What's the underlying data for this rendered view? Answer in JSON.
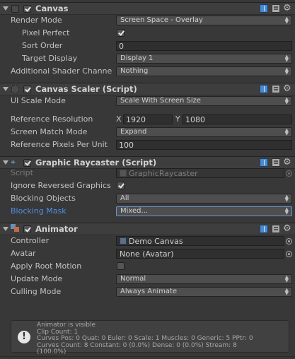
{
  "canvas": {
    "title": "Canvas",
    "render_mode_label": "Render Mode",
    "render_mode_value": "Screen Space - Overlay",
    "pixel_perfect_label": "Pixel Perfect",
    "sort_order_label": "Sort Order",
    "sort_order_value": "0",
    "target_display_label": "Target Display",
    "target_display_value": "Display 1",
    "shader_channels_label": "Additional Shader Channe",
    "shader_channels_value": "Nothing"
  },
  "canvas_scaler": {
    "title": "Canvas Scaler (Script)",
    "ui_scale_mode_label": "UI Scale Mode",
    "ui_scale_mode_value": "Scale With Screen Size",
    "ref_resolution_label": "Reference Resolution",
    "x_label": "X",
    "x_value": "1920",
    "y_label": "Y",
    "y_value": "1080",
    "match_mode_label": "Screen Match Mode",
    "match_mode_value": "Expand",
    "ref_ppu_label": "Reference Pixels Per Unit",
    "ref_ppu_value": "100"
  },
  "graphic_raycaster": {
    "title": "Graphic Raycaster (Script)",
    "script_label": "Script",
    "script_value": "GraphicRaycaster",
    "ignore_reversed_label": "Ignore Reversed Graphics",
    "blocking_objects_label": "Blocking Objects",
    "blocking_objects_value": "All",
    "blocking_mask_label": "Blocking Mask",
    "blocking_mask_value": "Mixed..."
  },
  "animator": {
    "title": "Animator",
    "controller_label": "Controller",
    "controller_value": "Demo Canvas",
    "avatar_label": "Avatar",
    "avatar_value": "None (Avatar)",
    "apply_root_motion_label": "Apply Root Motion",
    "update_mode_label": "Update Mode",
    "update_mode_value": "Normal",
    "culling_mode_label": "Culling Mode",
    "culling_mode_value": "Always Animate",
    "info_text": "Animator is visible\nClip Count: 1\nCurves Pos: 0 Quat: 0 Euler: 0 Scale: 1 Muscles: 0 Generic: 5 PPtr: 0\nCurves Count: 8 Constant: 0 (0.0%) Dense: 0 (0.0%) Stream: 8\n(100.0%)"
  },
  "icons": {
    "help": "book-icon",
    "preset": "preset-icon",
    "settings": "gear-icon",
    "object_picker": "object-picker-icon",
    "info": "exclamation-icon"
  }
}
